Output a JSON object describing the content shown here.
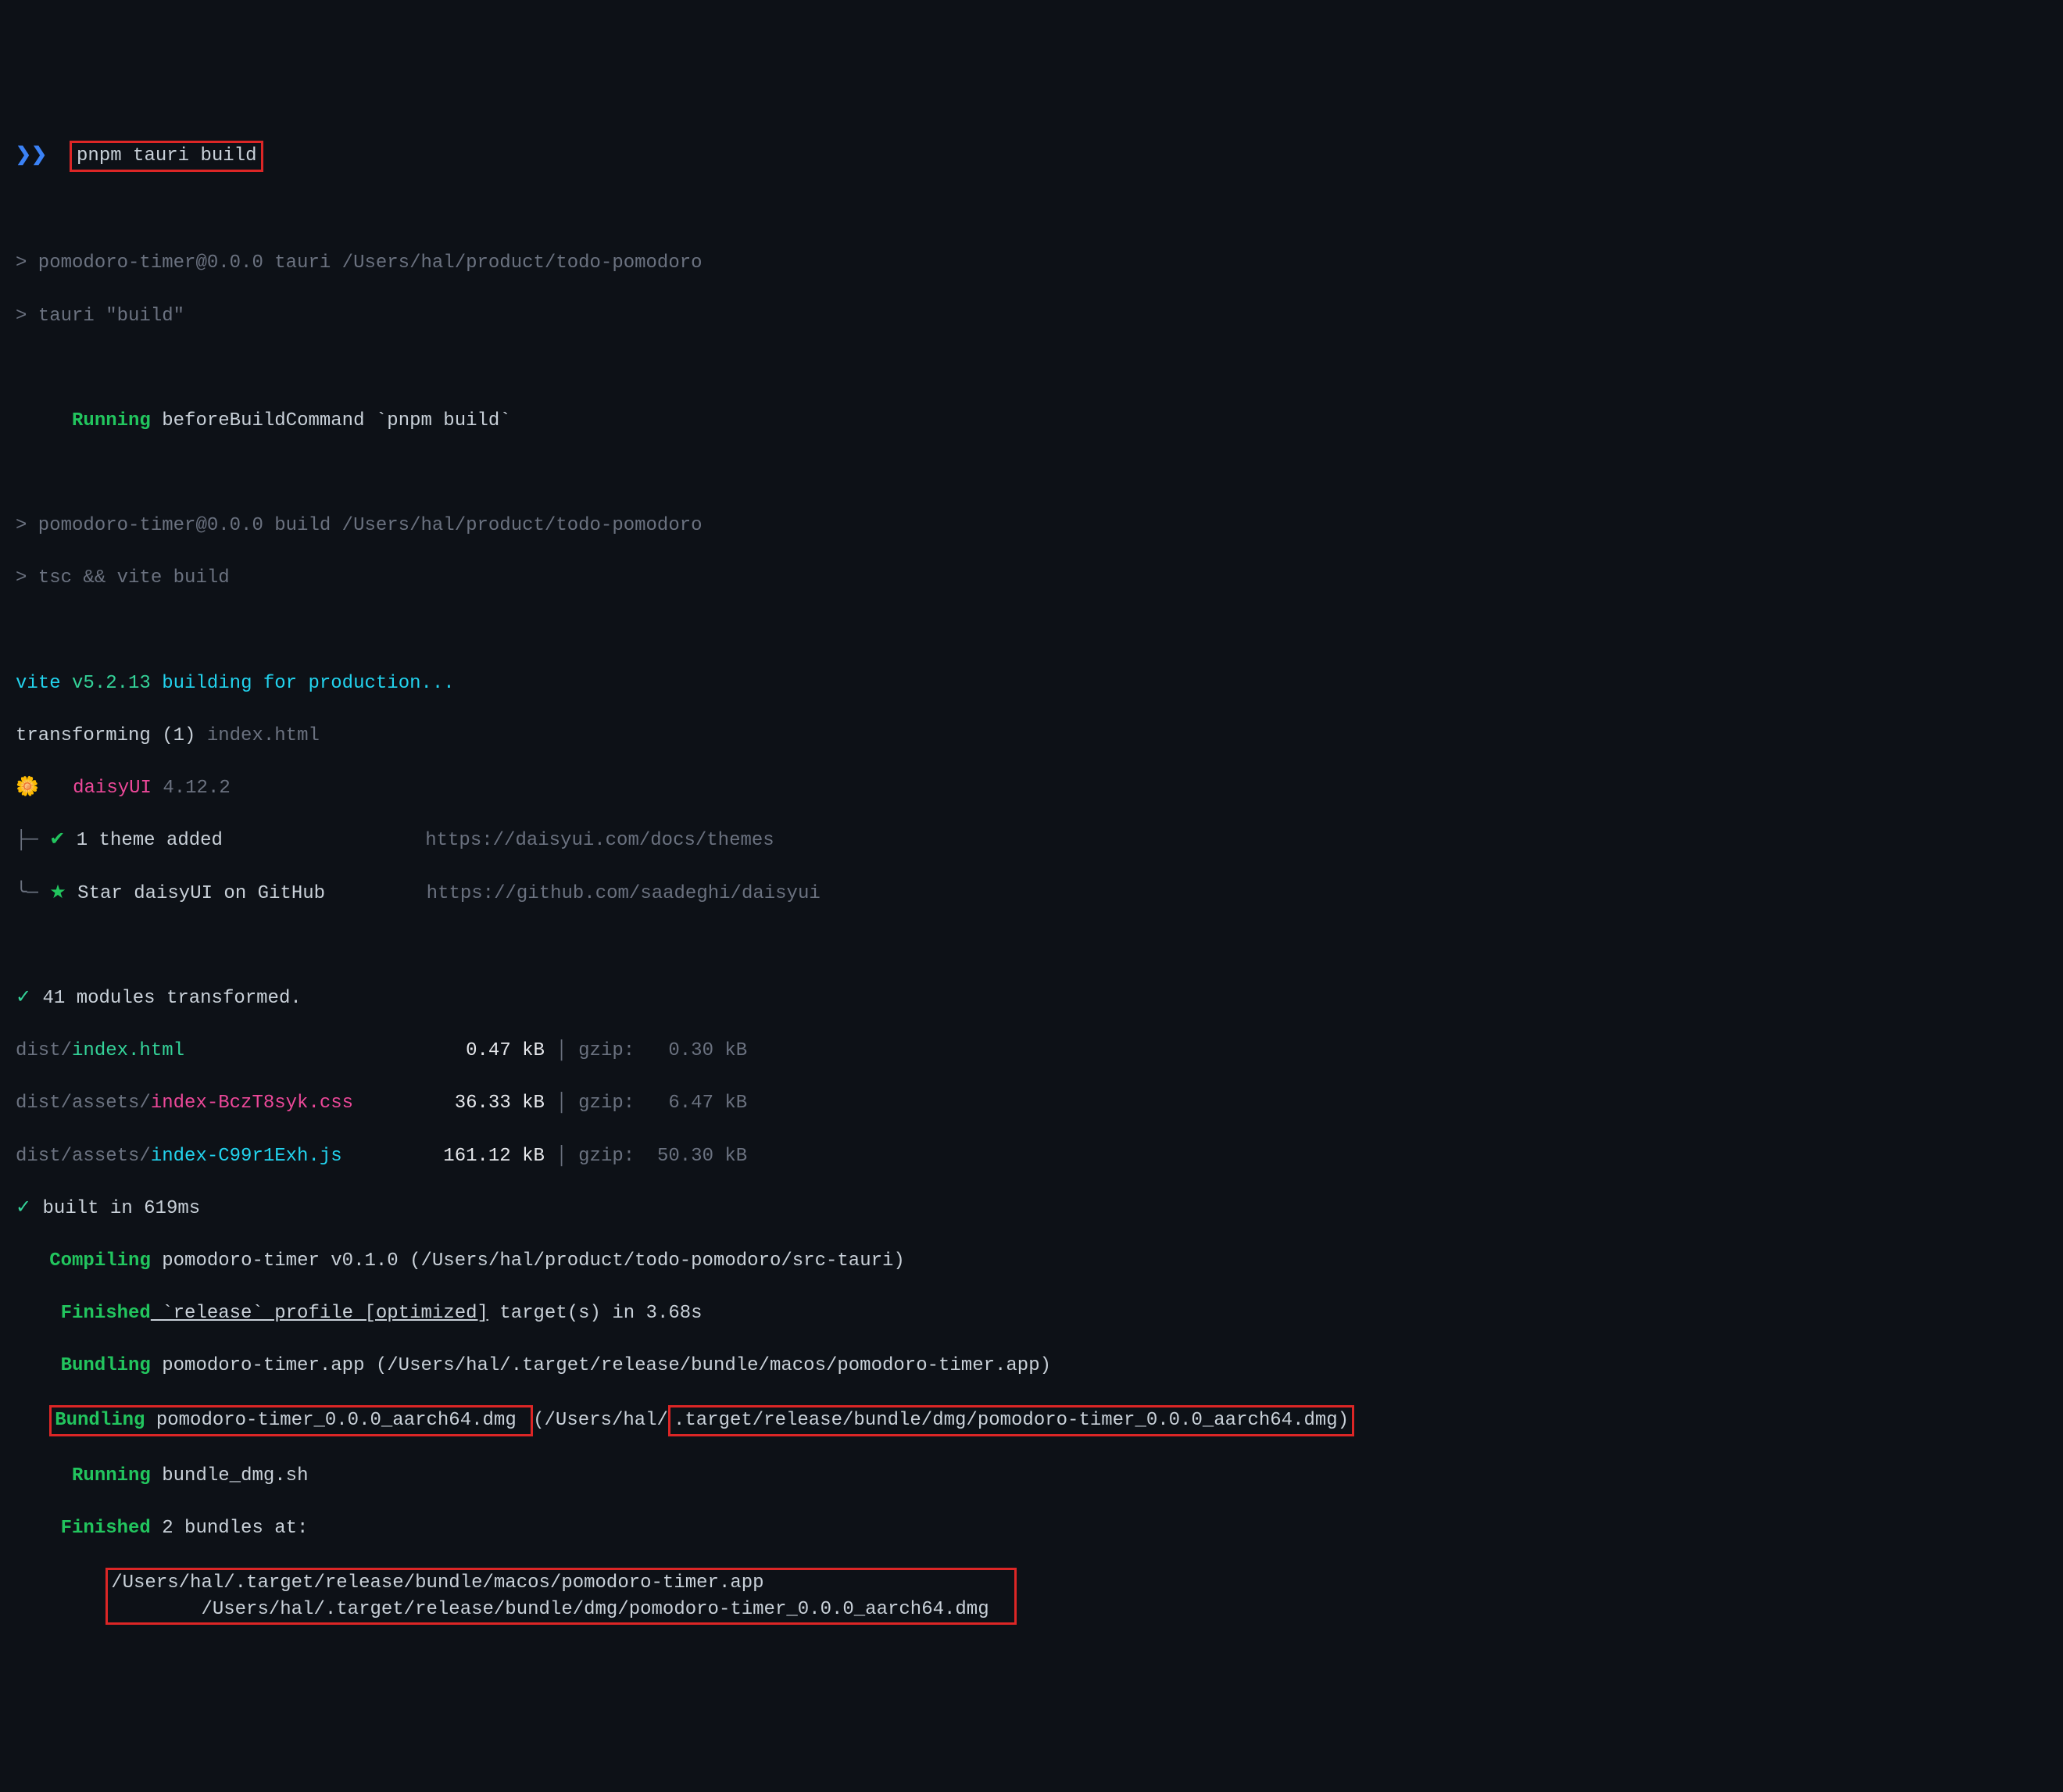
{
  "prompt": {
    "arrows": "❯❯",
    "command": "pnpm tauri build"
  },
  "header1": {
    "line1": "> pomodoro-timer@0.0.0 tauri /Users/hal/product/todo-pomodoro",
    "line2": "> tauri \"build\""
  },
  "running": {
    "label": "Running",
    "text": " beforeBuildCommand `pnpm build`"
  },
  "header2": {
    "line1": "> pomodoro-timer@0.0.0 build /Users/hal/product/todo-pomodoro",
    "line2": "> tsc && vite build"
  },
  "vite": {
    "prefix": "vite ",
    "version": "v5.2.13",
    "suffix": " building for production..."
  },
  "transforming": {
    "label": "transforming (1) ",
    "file": "index.html"
  },
  "daisy": {
    "flower": "🌼",
    "name": "daisyUI",
    "version": "4.12.2",
    "theme_check": "✔",
    "theme_text": " 1 theme added",
    "theme_url": "https://daisyui.com/docs/themes",
    "star": "★",
    "star_text": " Star daisyUI on GitHub",
    "star_url": "https://github.com/saadeghi/daisyui"
  },
  "modules": {
    "check": "✓",
    "text": " 41 modules transformed."
  },
  "files": [
    {
      "path_dim": "dist/",
      "path": "index.html",
      "size": "   0.47 kB",
      "gzip": "gzip:   0.30 kB"
    },
    {
      "path_dim": "dist/assets/",
      "path": "index-BczT8syk.css",
      "size": "  36.33 kB",
      "gzip": "gzip:   6.47 kB"
    },
    {
      "path_dim": "dist/assets/",
      "path": "index-C99r1Exh.js",
      "size": " 161.12 kB",
      "gzip": "gzip:  50.30 kB"
    }
  ],
  "built": {
    "check": "✓",
    "text": " built in 619ms"
  },
  "cargo": {
    "compiling_label": "Compiling",
    "compiling_text": " pomodoro-timer v0.1.0 (/Users/hal/product/todo-pomodoro/src-tauri)",
    "finished1_label": "Finished",
    "finished1_text_a": " `release` profile [optimized]",
    "finished1_text_b": " target(s) in 3.68s",
    "bundling1_label": "Bundling",
    "bundling1_text": " pomodoro-timer.app (/Users/hal/.target/release/bundle/macos/pomodoro-timer.app)",
    "bundling2_label": "Bundling",
    "bundling2_file": " pomodoro-timer_0.0.0_aarch64.dmg ",
    "bundling2_mid": "(/Users/hal/",
    "bundling2_path": ".target/release/bundle/dmg/pomodoro-timer_0.0.0_aarch64.dmg)",
    "running2_label": "Running",
    "running2_text": " bundle_dmg.sh",
    "finished2_label": "Finished",
    "finished2_text": " 2 bundles at:",
    "bundle_path1": "/Users/hal/.target/release/bundle/macos/pomodoro-timer.app",
    "bundle_path2": "/Users/hal/.target/release/bundle/dmg/pomodoro-timer_0.0.0_aarch64.dmg"
  }
}
